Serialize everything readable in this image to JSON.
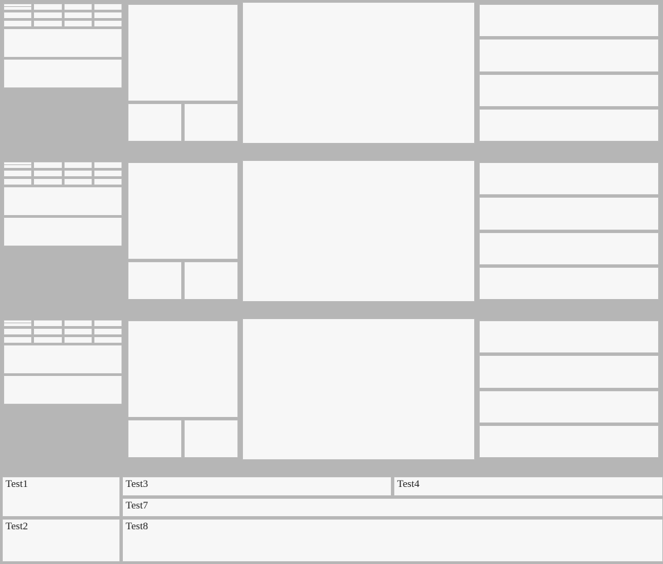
{
  "bottom": {
    "test1": "Test1",
    "test2": "Test2",
    "test3": "Test3",
    "test4": "Test4",
    "test7": "Test7",
    "test8": "Test8"
  }
}
